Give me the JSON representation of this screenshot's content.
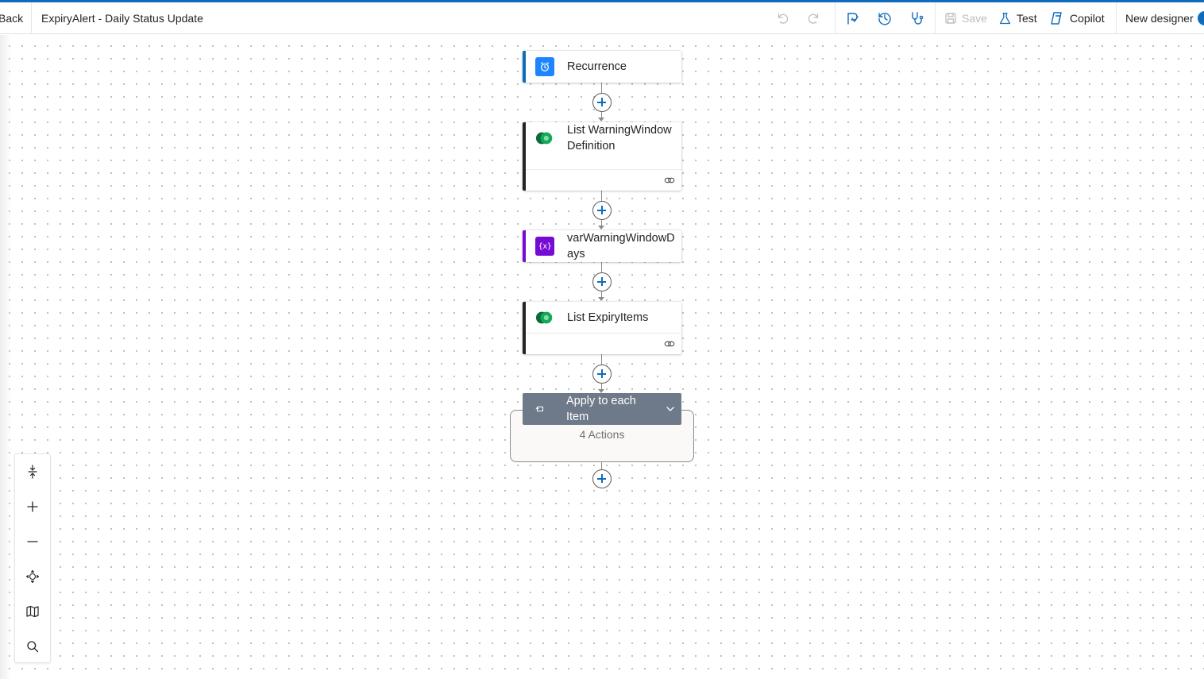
{
  "header": {
    "back_label": "Back",
    "flow_title": "ExpiryAlert - Daily Status Update",
    "save_label": "Save",
    "test_label": "Test",
    "copilot_label": "Copilot",
    "new_designer_label": "New designer",
    "icons": [
      "undo-icon",
      "redo-icon",
      "flow-checker-icon",
      "version-history-icon",
      "stethoscope-icon",
      "save-icon",
      "flask-icon",
      "copilot-icon"
    ],
    "toggle_on": true
  },
  "flow": {
    "steps": [
      {
        "title": "Recurrence",
        "icon": "alarm-clock-icon",
        "accent": "#0f6cbd"
      },
      {
        "title": "List WarningWindowDefinition",
        "icon": "dataverse-icon",
        "accent": "#242424"
      },
      {
        "title": "varWarningWindowDays",
        "icon": "variable-icon",
        "accent": "#770bd6"
      },
      {
        "title": "List ExpiryItems",
        "icon": "dataverse-icon",
        "accent": "#242424"
      }
    ],
    "loop": {
      "title": "Apply to each Item",
      "actions_label": "4 Actions",
      "header_color": "#6e7a8a"
    }
  },
  "canvas_controls": [
    "fit-height-icon",
    "zoom-in-icon",
    "zoom-out-icon",
    "fit-view-icon",
    "minimap-icon",
    "search-icon"
  ],
  "colors": {
    "accent": "#0f6cbd",
    "dataverse_green": "#0c9b4e",
    "variable_purple": "#770bd6"
  }
}
